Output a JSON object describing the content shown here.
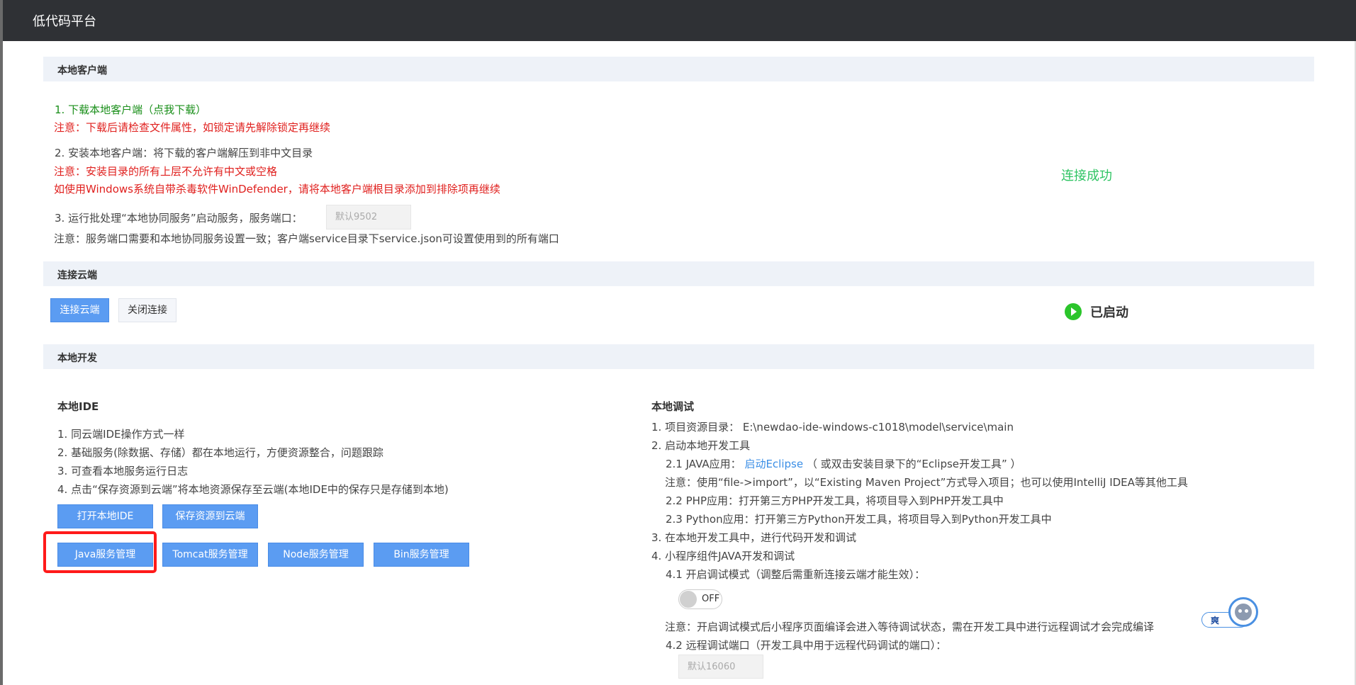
{
  "header": {
    "title": "低代码平台"
  },
  "local_client": {
    "section_title": "本地客户端",
    "step1": "1. 下载本地客户端（点我下载）",
    "step1_note": "注意：下载后请检查文件属性，如锁定请先解除锁定再继续",
    "step2": "2. 安装本地客户端：将下载的客户端解压到非中文目录",
    "step2_note1": "注意：安装目录的所有上层不允许有中文或空格",
    "step2_note2": "如使用Windows系统自带杀毒软件WinDefender，请将本地客户端根目录添加到排除项再继续",
    "step3": "3. 运行批处理“本地协同服务”启动服务，服务端口：",
    "port_placeholder": "默认9502",
    "step3_note": "注意：服务端口需要和本地协同服务设置一致；客户端service目录下service.json可设置使用到的所有端口",
    "status": "连接成功"
  },
  "cloud": {
    "section_title": "连接云端",
    "connect_label": "连接云端",
    "disconnect_label": "关闭连接",
    "status": "已启动"
  },
  "local_dev": {
    "section_title": "本地开发",
    "ide": {
      "title": "本地IDE",
      "items": [
        "1. 同云端IDE操作方式一样",
        "2. 基础服务(除数据、存储）都在本地运行，方便资源整合，问题跟踪",
        "3. 可查看本地服务运行日志",
        "4. 点击“保存资源到云端”将本地资源保存至云端(本地IDE中的保存只是存储到本地)"
      ],
      "buttons": {
        "open_ide": "打开本地IDE",
        "save_cloud": "保存资源到云端",
        "java": "Java服务管理",
        "tomcat": "Tomcat服务管理",
        "node": "Node服务管理",
        "bin": "Bin服务管理"
      }
    },
    "debug": {
      "title": "本地调试",
      "line1": "1. 项目资源目录：  E:\\newdao-ide-windows-c1018\\model\\service\\main",
      "line2": "2. 启动本地开发工具",
      "java_prefix": "2.1 JAVA应用：",
      "java_link": "启动Eclipse",
      "java_suffix": "（ 或双击安装目录下的“Eclipse开发工具” ）",
      "java_note": "注意：使用“file->import”，以“Existing Maven Project”方式导入项目；也可以使用IntelliJ IDEA等其他工具",
      "php": "2.2 PHP应用：打开第三方PHP开发工具，将项目导入到PHP开发工具中",
      "python": "2.3 Python应用：打开第三方Python开发工具，将项目导入到Python开发工具中",
      "line3": "3. 在本地开发工具中，进行代码开发和调试",
      "line4": "4. 小程序组件JAVA开发和调试",
      "debug_mode": "4.1 开启调试模式（调整后需重新连接云端才能生效）：",
      "toggle_label": "OFF",
      "debug_note": "注意：开启调试模式后小程序页面编译会进入等待调试状态，需在开发工具中进行远程调试才会完成编译",
      "remote_port": "4.2 远程调试端口（开发工具中用于远程代码调试的端口）：",
      "remote_port_placeholder": "默认16060"
    }
  },
  "widget": {
    "label": "爽"
  }
}
